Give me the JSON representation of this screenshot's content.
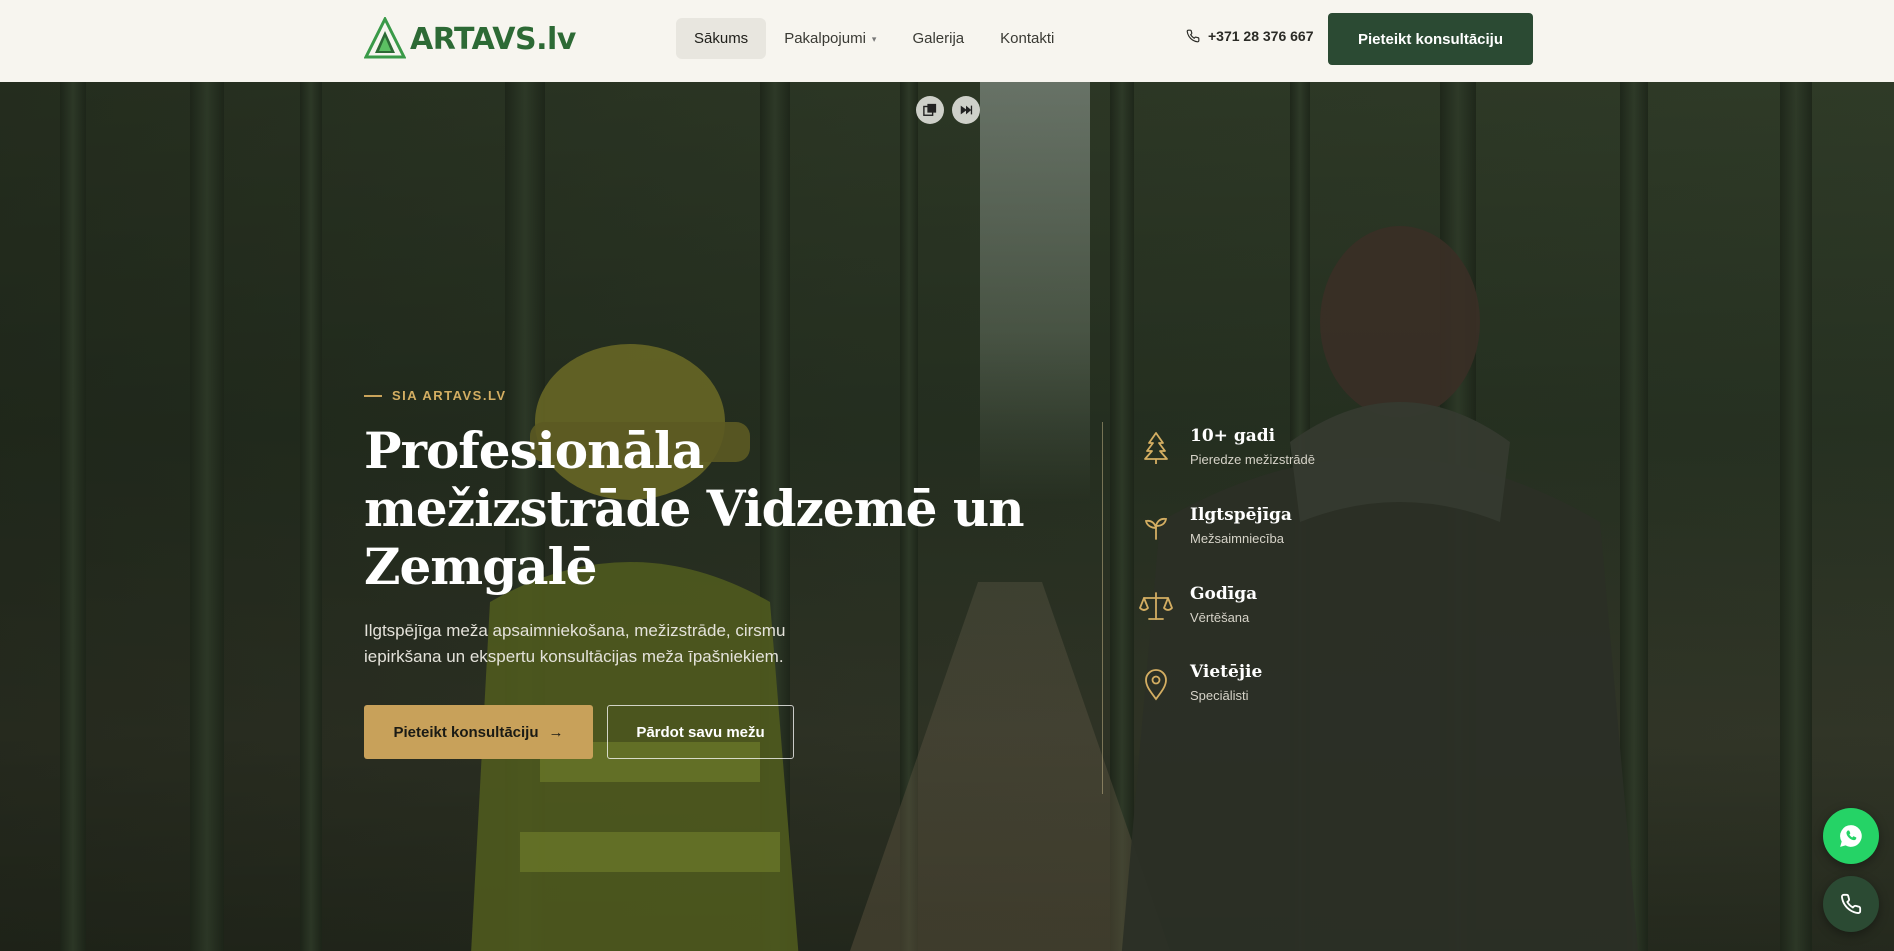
{
  "header": {
    "logo_text": "ARTAVS.lv",
    "nav": [
      {
        "label": "Sākums",
        "active": true
      },
      {
        "label": "Pakalpojumi",
        "dropdown": true
      },
      {
        "label": "Galerija"
      },
      {
        "label": "Kontakti"
      }
    ],
    "phone": "+371 28 376 667",
    "cta_label": "Pieteikt konsultāciju"
  },
  "hero": {
    "eyebrow": "SIA ARTAVS.LV",
    "headline": "Profesionāla mežizstrāde Vidzemē un Zemgalē",
    "subtext": "Ilgtspējīga meža apsaimniekošana, mežizstrāde, cirsmu iepirkšana un ekspertu konsultācijas meža īpašniekiem.",
    "primary_button": "Pieteikt konsultāciju",
    "secondary_button": "Pārdot savu mežu",
    "features": [
      {
        "icon": "tree-icon",
        "title": "10+ gadi",
        "subtitle": "Pieredze mežizstrādē"
      },
      {
        "icon": "sprout-icon",
        "title": "Ilgtspējīga",
        "subtitle": "Mežsaimniecība"
      },
      {
        "icon": "scales-icon",
        "title": "Godīga",
        "subtitle": "Vērtēšana"
      },
      {
        "icon": "map-pin-icon",
        "title": "Vietējie",
        "subtitle": "Speciālisti"
      }
    ]
  },
  "colors": {
    "brand_green": "#2b4a33",
    "logo_green": "#2d6a35",
    "gold_accent": "#c8a15a",
    "whatsapp": "#25d366"
  }
}
